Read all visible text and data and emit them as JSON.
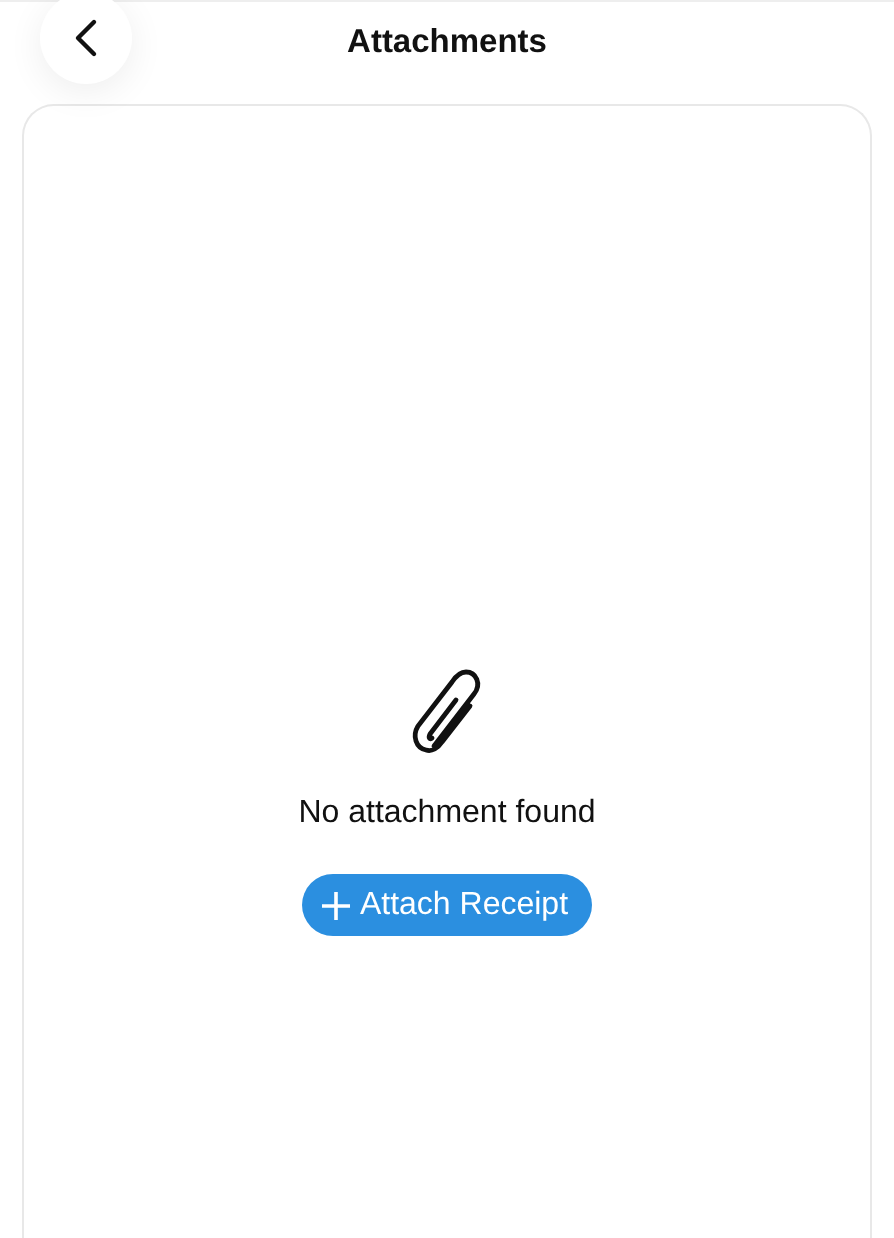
{
  "header": {
    "title": "Attachments"
  },
  "empty_state": {
    "message": "No attachment found",
    "button": "Attach Receipt"
  }
}
